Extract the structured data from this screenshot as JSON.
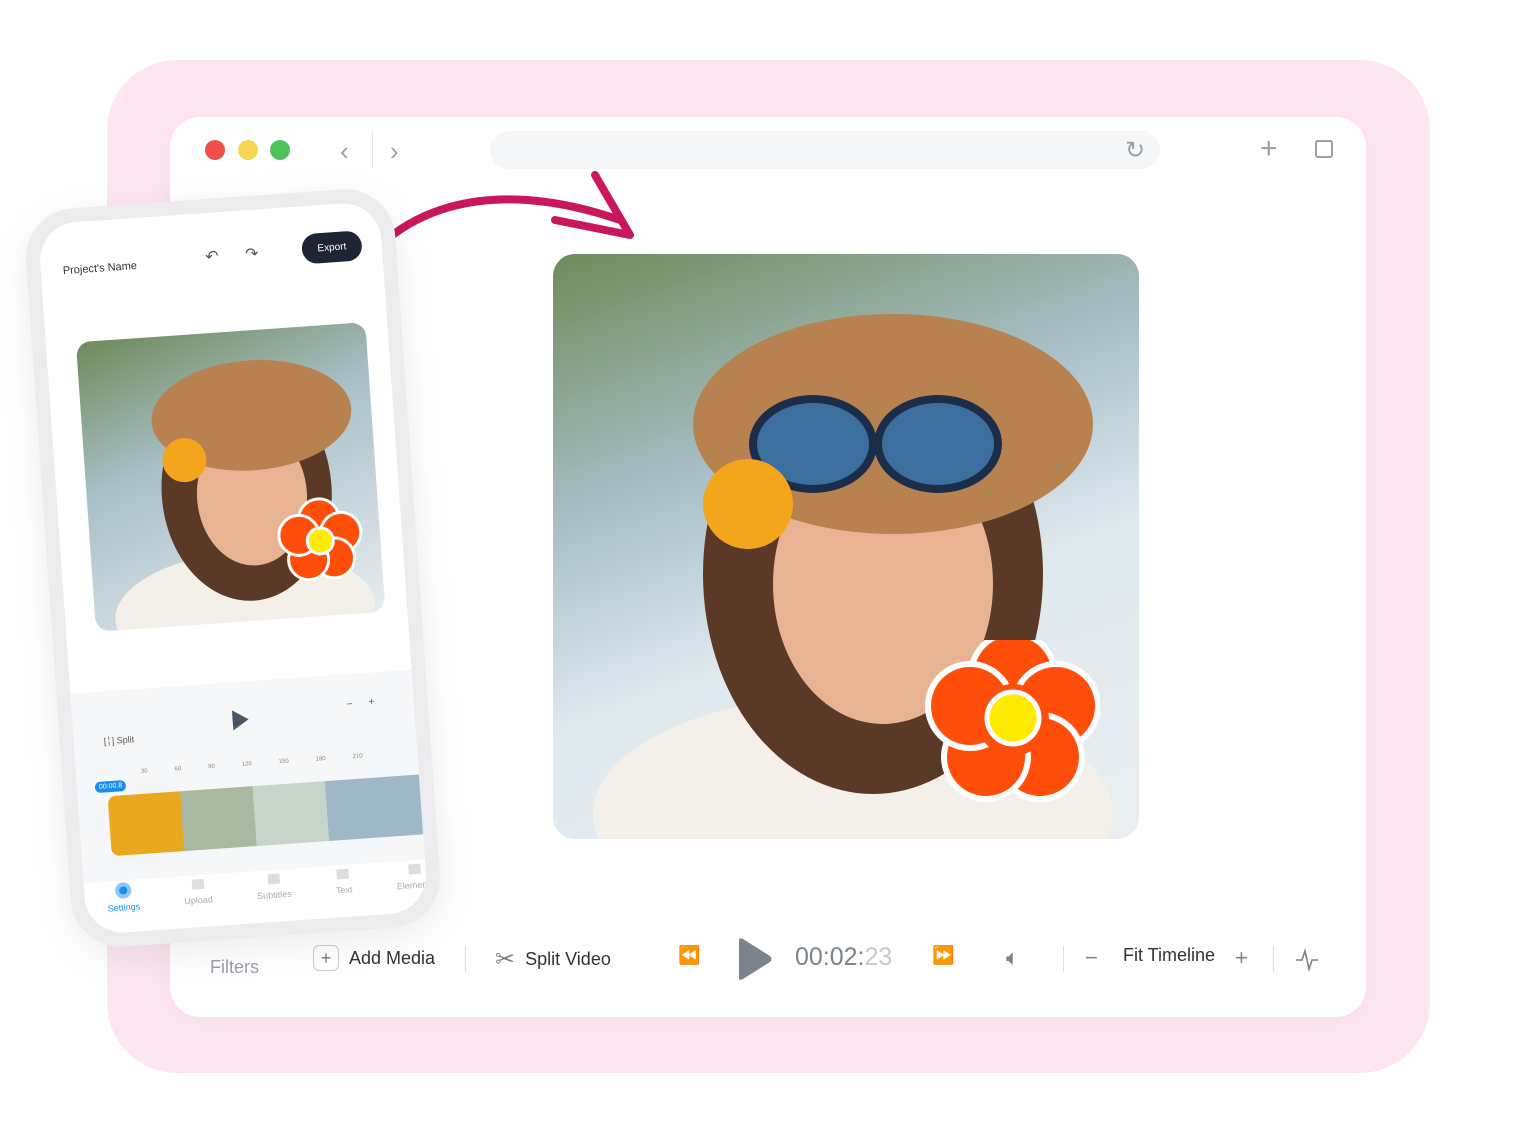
{
  "browser": {
    "traffic_lights": [
      "#f0504a",
      "#f6d552",
      "#4ec25a"
    ],
    "back_icon": "chevron-left-icon",
    "forward_icon": "chevron-right-icon",
    "reload_icon": "reload-icon",
    "new_tab_icon": "plus-icon",
    "tabs_icon": "copy-icon"
  },
  "toolbar": {
    "filters": "Filters",
    "add_media": "Add Media",
    "split_video": "Split Video",
    "time_main": "00:02:",
    "time_frames": "23",
    "fit_timeline": "Fit Timeline"
  },
  "phone": {
    "project_name": "Project's Name",
    "export": "Export",
    "split": "Split",
    "playhead": "00:00.8",
    "ticks": [
      "30",
      "60",
      "90",
      "120",
      "150",
      "180",
      "210"
    ],
    "nav": [
      "Settings",
      "Upload",
      "Subtitles",
      "Text",
      "Elements"
    ]
  },
  "colors": {
    "background_pink": "#fde6f1",
    "arrow": "#c8175a",
    "sticker": "#ff4d0a",
    "accent": "#1a8cf0"
  }
}
